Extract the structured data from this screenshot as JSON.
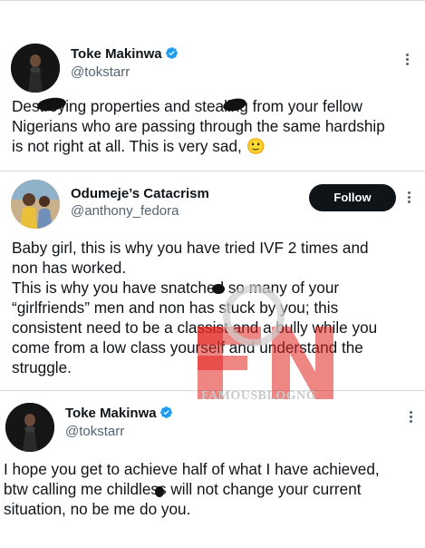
{
  "tweets": [
    {
      "name": "Toke Makinwa",
      "handle": "@tokstarr",
      "verified": true,
      "lines": [
        "Destroying properties and stealing from your fellow",
        "Nigerians who are passing through the same hardship",
        "is not right at all. This is very sad,"
      ],
      "emoji": "🙂"
    },
    {
      "name": "Odumeje’s Catacrism",
      "handle": "@anthony_fedora",
      "follow_label": "Follow",
      "lines": [
        "Baby girl, this is why you have tried IVF 2 times and",
        "non has worked.",
        "This is why you have snatched so many of your",
        "“girlfriends” men and non has stuck by you; this",
        "consistent need to be a classist and a bully while you",
        "come from a low class yourself and understand the",
        "struggle."
      ]
    },
    {
      "name": "Toke Makinwa",
      "handle": "@tokstarr",
      "verified": true,
      "lines": [
        "I hope you get to achieve half of what I have achieved,",
        "btw calling me childless will not change your current",
        "situation, no be me do you."
      ]
    }
  ],
  "watermark": {
    "text": "FAMOUSBLOGNG",
    "logo": "FBN",
    "color": "#e0231f"
  },
  "colors": {
    "verified": "#1d9bf0",
    "follow_bg": "#0f1419"
  }
}
